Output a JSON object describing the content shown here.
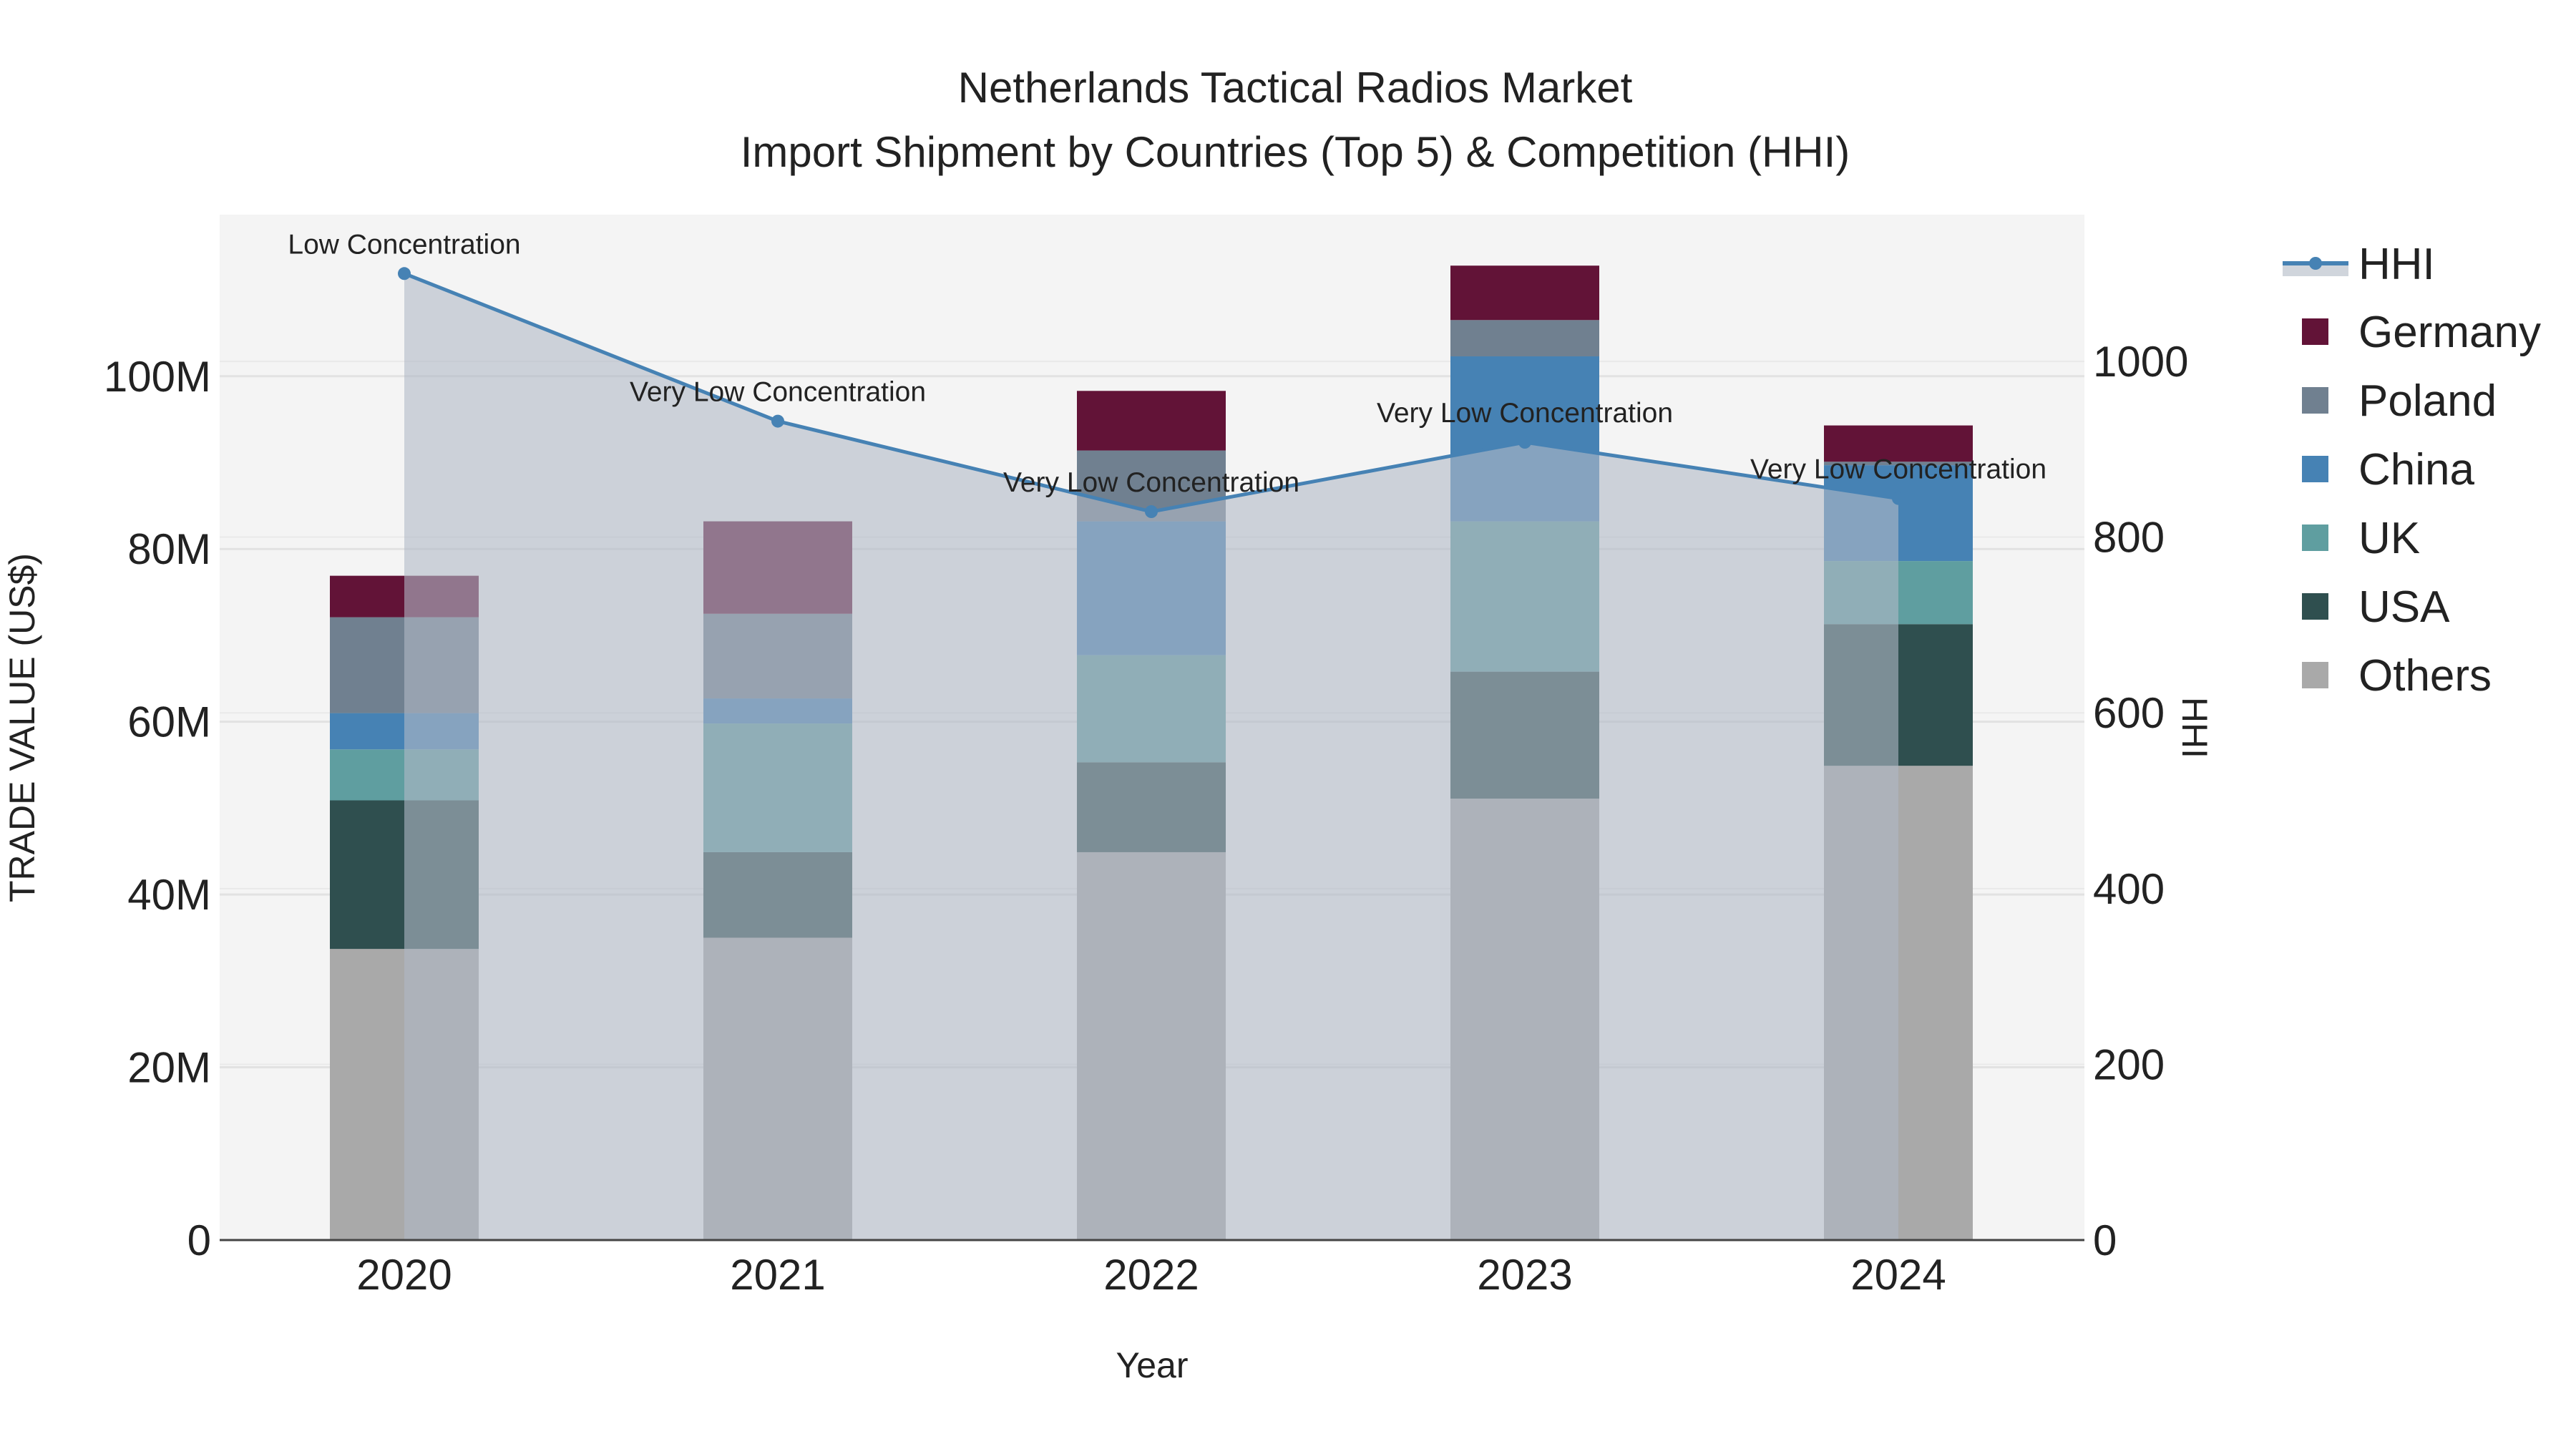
{
  "chart_data": {
    "type": "bar",
    "stacked": true,
    "title": "Netherlands Tactical Radios Market",
    "subtitle": "Import Shipment by Countries (Top 5) & Competition (HHI)",
    "xlabel": "Year",
    "ylabel": "TRADE VALUE (US$)",
    "y2label": "HHI",
    "categories": [
      "2020",
      "2021",
      "2022",
      "2023",
      "2024"
    ],
    "ylim": [
      0,
      118.7
    ],
    "y_unit": "M US$",
    "y_ticks": [
      0,
      20,
      40,
      60,
      80,
      100
    ],
    "y_tick_labels": [
      "0",
      "20M",
      "40M",
      "60M",
      "80M",
      "100M"
    ],
    "y2lim": [
      0,
      1167
    ],
    "y2_ticks": [
      0,
      200,
      400,
      600,
      800,
      1000
    ],
    "y2_tick_labels": [
      "0",
      "200",
      "400",
      "600",
      "800",
      "1000"
    ],
    "grid": true,
    "legend_position": "right",
    "series": [
      {
        "name": "Others",
        "color": "#a9a9a9",
        "values": [
          33.7,
          35.0,
          44.9,
          51.1,
          54.9
        ]
      },
      {
        "name": "USA",
        "color": "#2f4f4f",
        "values": [
          17.2,
          9.9,
          10.4,
          14.7,
          16.4
        ]
      },
      {
        "name": "UK",
        "color": "#5f9ea0",
        "values": [
          5.9,
          14.9,
          12.4,
          17.4,
          7.3
        ]
      },
      {
        "name": "China",
        "color": "#4682b4",
        "values": [
          4.2,
          2.9,
          15.5,
          19.1,
          11.1
        ]
      },
      {
        "name": "Poland",
        "color": "#708090",
        "values": [
          11.1,
          9.8,
          8.2,
          4.2,
          0.4
        ]
      },
      {
        "name": "Germany",
        "color": "#621337",
        "values": [
          4.8,
          10.7,
          6.9,
          6.3,
          4.2
        ]
      }
    ],
    "line": {
      "name": "HHI",
      "axis": "right",
      "color": "#4682b4",
      "fill_color": "#b0b9c6",
      "values": [
        1100,
        932,
        829,
        908,
        844
      ],
      "annotations": [
        "Low Concentration",
        "Very Low Concentration",
        "Very Low Concentration",
        "Very Low Concentration",
        "Very Low Concentration"
      ]
    },
    "legend_order": [
      "HHI",
      "Germany",
      "Poland",
      "China",
      "UK",
      "USA",
      "Others"
    ]
  }
}
